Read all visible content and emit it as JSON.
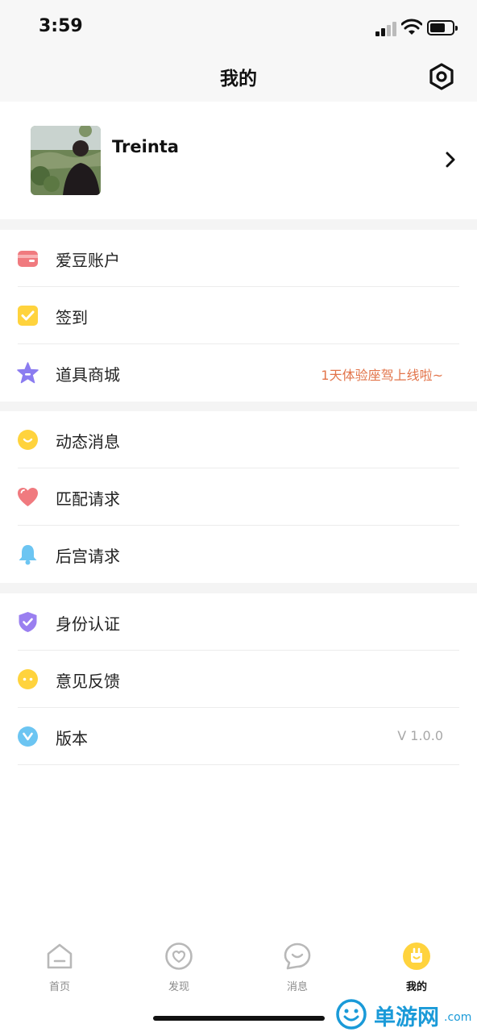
{
  "status_bar": {
    "time": "3:59"
  },
  "header": {
    "title": "我的",
    "settings_icon": "settings-hex-icon"
  },
  "profile": {
    "name": "Treinta"
  },
  "sections": [
    {
      "items": [
        {
          "label": "爱豆账户",
          "icon": "wallet-icon",
          "color": "#f07a7f"
        },
        {
          "label": "签到",
          "icon": "checkin-icon",
          "color": "#ffd33d"
        },
        {
          "label": "道具商城",
          "icon": "star-icon",
          "color": "#8b7cf0",
          "extra": "1天体验座驾上线啦~"
        }
      ]
    },
    {
      "items": [
        {
          "label": "动态消息",
          "icon": "smile-icon",
          "color": "#ffd33d"
        },
        {
          "label": "匹配请求",
          "icon": "heart-icon",
          "color": "#f07a7f"
        },
        {
          "label": "后宫请求",
          "icon": "bell-icon",
          "color": "#6cc5f2"
        }
      ]
    },
    {
      "items": [
        {
          "label": "身份认证",
          "icon": "shield-check-icon",
          "color": "#9a7ff0"
        },
        {
          "label": "意见反馈",
          "icon": "feedback-face-icon",
          "color": "#ffd33d"
        },
        {
          "label": "版本",
          "icon": "version-v-icon",
          "color": "#6cc5f2",
          "extra": "V 1.0.0"
        }
      ]
    }
  ],
  "tabbar": {
    "tabs": [
      {
        "label": "首页",
        "icon": "home-icon",
        "active": false
      },
      {
        "label": "发现",
        "icon": "discover-heart-icon",
        "active": false
      },
      {
        "label": "消息",
        "icon": "message-icon",
        "active": false
      },
      {
        "label": "我的",
        "icon": "me-icon",
        "active": true
      }
    ]
  },
  "watermark": {
    "text": "单游网",
    "suffix": ".com"
  },
  "colors": {
    "accent_yellow": "#ffd33d",
    "promo_orange": "#e2744a",
    "background": "#f4f4f4"
  }
}
